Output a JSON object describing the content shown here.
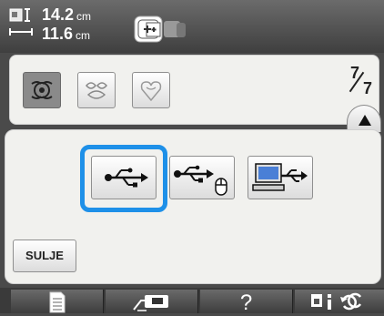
{
  "header": {
    "height_value": "14.2",
    "width_value": "11.6",
    "unit": "cm"
  },
  "patterns": {
    "page_current": "7",
    "page_total": "7",
    "selected_index": 0
  },
  "select_panel": {
    "close_label": "SULJE",
    "selected_option": "usb-media",
    "highlight_color": "#1e90e8"
  },
  "footer": {
    "help_label": "?"
  },
  "icons": [
    "size-icon",
    "hoop-icon",
    "usb-icon",
    "usb-mouse-icon",
    "computer-icon",
    "document-icon",
    "sewing-machine-icon",
    "settings-icon"
  ]
}
